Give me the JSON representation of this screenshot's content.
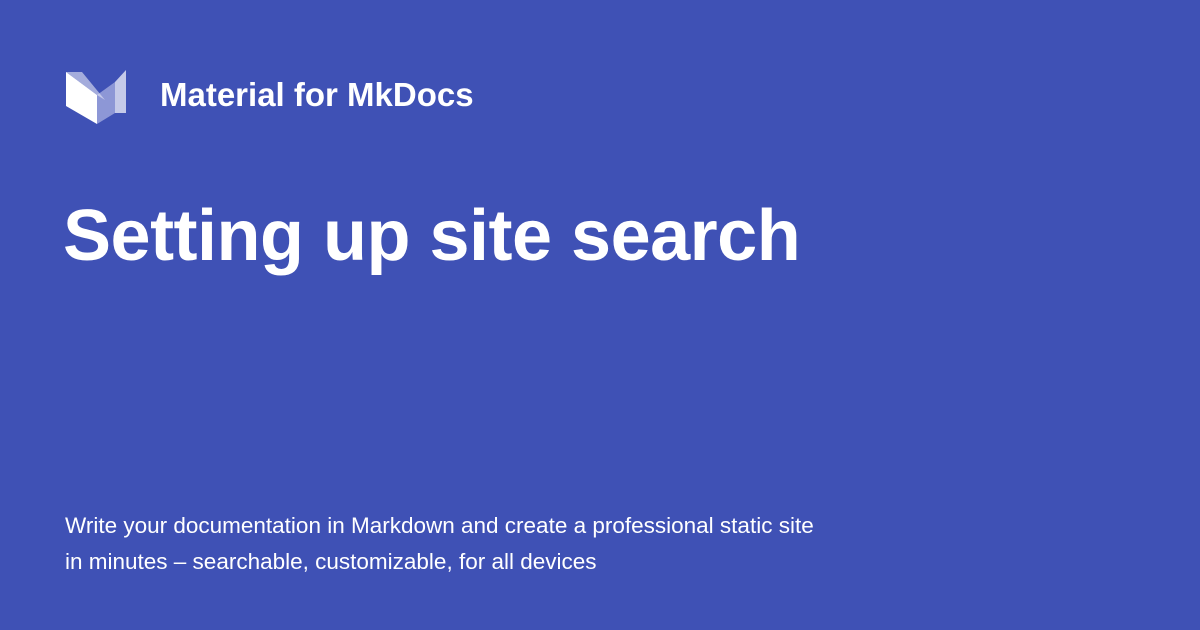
{
  "site": {
    "name": "Material for MkDocs",
    "logo_icon": "material-mkdocs-logo-icon"
  },
  "page": {
    "title": "Setting up site search"
  },
  "description": {
    "lines": [
      "Write your documentation in Markdown and create a professional static site",
      "in minutes – searchable, customizable, for all devices"
    ]
  },
  "colors": {
    "background": "#3F51B5",
    "text": "#FFFFFF"
  }
}
